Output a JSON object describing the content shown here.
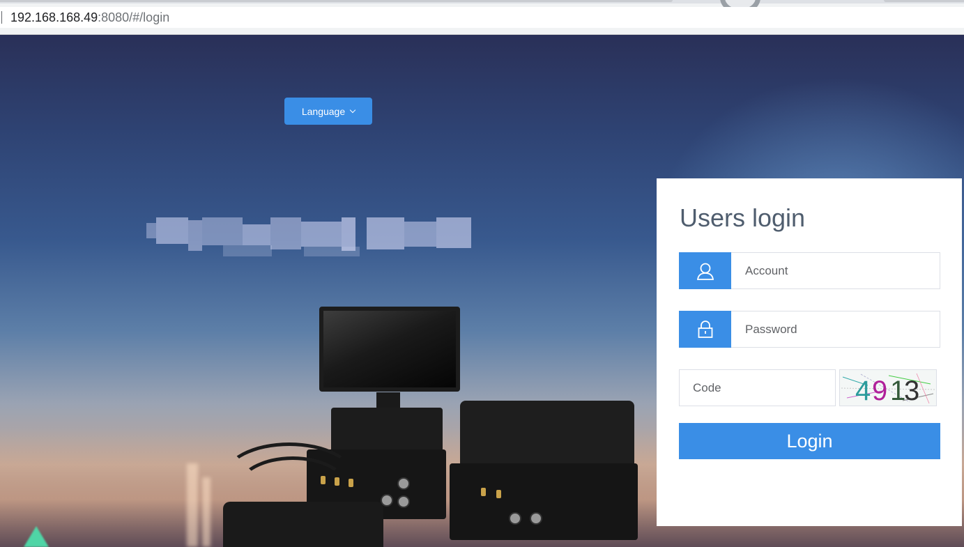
{
  "browser": {
    "address_host": "192.168.168.49",
    "address_path": ":8080/#/login"
  },
  "language_button": {
    "label": "Language",
    "icon": "chevron-down-icon"
  },
  "login": {
    "title": "Users login",
    "account": {
      "placeholder": "Account",
      "icon": "user-icon"
    },
    "password": {
      "placeholder": "Password",
      "icon": "lock-icon"
    },
    "code": {
      "placeholder": "Code"
    },
    "captcha": {
      "digits": [
        "4",
        "9",
        "1",
        "3"
      ]
    },
    "button_label": "Login"
  },
  "colors": {
    "accent": "#3a8ee6",
    "title_text": "#4f5d6e",
    "input_border": "#dcdfe6"
  }
}
